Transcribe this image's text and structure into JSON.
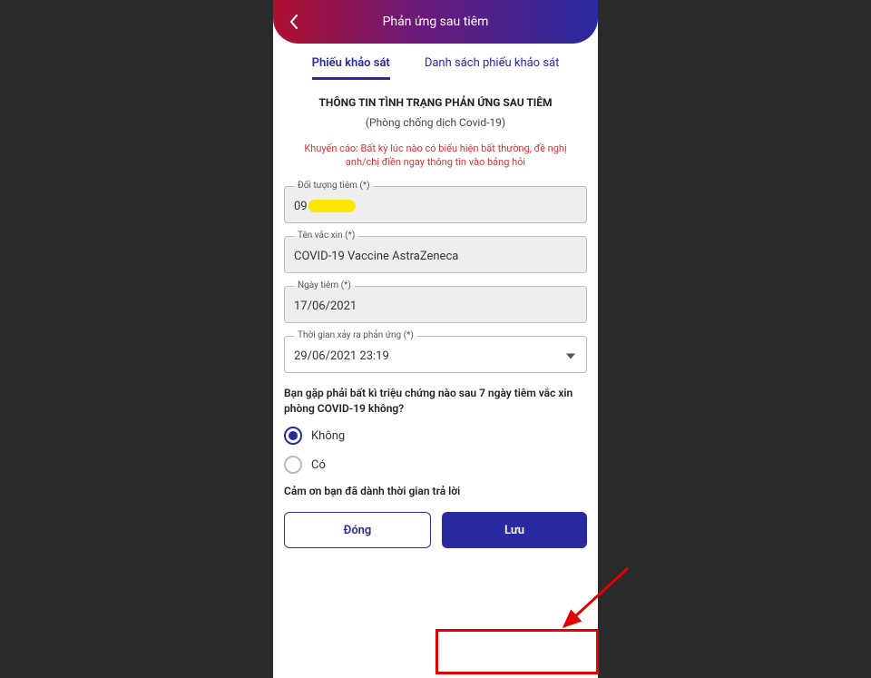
{
  "header": {
    "title": "Phản ứng sau tiêm"
  },
  "tabs": {
    "survey": "Phiếu khảo sát",
    "list": "Danh sách phiếu khảo sát"
  },
  "section": {
    "title": "THÔNG TIN TÌNH TRẠNG PHẢN ỨNG SAU TIÊM",
    "sub": "(Phòng chống dịch Covid-19)",
    "warning": "Khuyến cáo: Bất kỳ lúc nào có biểu hiện bất thường, đề nghị anh/chị điền ngay thông tin vào bảng hỏi"
  },
  "fields": {
    "subject": {
      "label": "Đối tượng tiêm (*)",
      "value_prefix": "09"
    },
    "vaccine": {
      "label": "Tên vắc xin (*)",
      "value": "COVID-19 Vaccine AstraZeneca"
    },
    "date": {
      "label": "Ngày tiêm (*)",
      "value": "17/06/2021"
    },
    "reaction_time": {
      "label": "Thời gian xảy ra phản ứng (*)",
      "value": "29/06/2021 23:19"
    }
  },
  "question": "Bạn gặp phải bất kì triệu chứng nào sau 7 ngày tiêm vắc xin phòng COVID-19 không?",
  "options": {
    "no": "Không",
    "yes": "Có"
  },
  "thanks": "Cảm ơn bạn đã dành thời gian trả lời",
  "buttons": {
    "close": "Đóng",
    "save": "Lưu"
  }
}
